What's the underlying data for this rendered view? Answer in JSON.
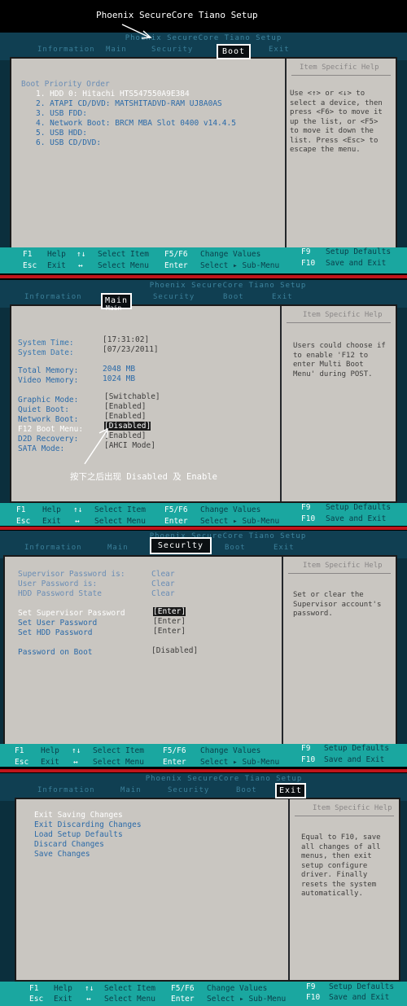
{
  "top_title": "Phoenix SecureCore Tiano Setup",
  "bios_title": "Phoenix SecureCore Tiano Setup",
  "tabs": [
    "Information",
    "Main",
    "Security",
    "Boot",
    "Exit"
  ],
  "footer": {
    "f1": "F1",
    "help": "Help",
    "arrows_ud": "↑↓",
    "select_item": "Select Item",
    "f5f6": "F5/F6",
    "change_values": "Change Values",
    "f9": "F9",
    "setup_defaults": "Setup Defaults",
    "esc": "Esc",
    "exit": "Exit",
    "arrows_lr": "↔",
    "select_menu": "Select Menu",
    "enter": "Enter",
    "select_submenu": "Select ▸ Sub-Menu",
    "f10": "F10",
    "save_exit": "Save and Exit"
  },
  "help_header": "Item Specific Help",
  "panel1": {
    "label": "Boot",
    "heading": "Boot Priority Order",
    "items": [
      "1. HDD 0: Hitachi HTS547550A9E384",
      "2. ATAPI CD/DVD: MATSHITADVD-RAM UJ8A0AS",
      "3. USB FDD:",
      "4. Network Boot: BRCM MBA Slot 0400 v14.4.5",
      "5. USB HDD:",
      "6. USB CD/DVD:"
    ],
    "help": "Use <↑> or <↓> to\nselect a device, then\npress <F6> to move it\nup the list, or <F5>\nto move it down the\nlist. Press <Esc> to\nescape the menu."
  },
  "panel2": {
    "label": "Main",
    "under_label": "Main",
    "rows": [
      {
        "label": "System Time:",
        "value": "[17:31:02]"
      },
      {
        "label": "System Date:",
        "value": "[07/23/2011]"
      },
      {
        "label": "Total Memory:",
        "value": "2048 MB"
      },
      {
        "label": "Video Memory:",
        "value": "1024 MB"
      },
      {
        "label": "Graphic Mode:",
        "value": "[Switchable]"
      },
      {
        "label": "Quiet Boot:",
        "value": "[Enabled]"
      },
      {
        "label": "Network Boot:",
        "value": "[Enabled]"
      },
      {
        "label": "F12 Boot Menu:",
        "value": "[Disabled]"
      },
      {
        "label": "D2D Recovery:",
        "value": "[Enabled]"
      },
      {
        "label": "SATA Mode:",
        "value": "[AHCI Mode]"
      }
    ],
    "help": "Users could choose if\nto enable 'F12 to\nenter Multi Boot\nMenu' during POST.",
    "caption": "按下之后出现 Disabled 及 Enable"
  },
  "panel3": {
    "label": "Securlty",
    "rows": [
      {
        "label": "Supervisor Password is:",
        "value": "Clear"
      },
      {
        "label": "User Password is:",
        "value": "Clear"
      },
      {
        "label": "HDD Password State",
        "value": "Clear"
      },
      {
        "label": "Set Supervisor Password",
        "value": "[Enter]"
      },
      {
        "label": "Set User Password",
        "value": "[Enter]"
      },
      {
        "label": "Set HDD Password",
        "value": "[Enter]"
      },
      {
        "label": "Password on Boot",
        "value": "[Disabled]"
      }
    ],
    "help": "Set or clear the\nSupervisor account's\npassword."
  },
  "panel4": {
    "label": "Exit",
    "items": [
      "Exit Saving Changes",
      "Exit Discarding Changes",
      "Load Setup Defaults",
      "Discard Changes",
      "Save Changes"
    ],
    "help": "Equal to F10, save\nall changes of all\nmenus, then exit\nsetup configure\ndriver. Finally\nresets the system\nautomatically."
  }
}
